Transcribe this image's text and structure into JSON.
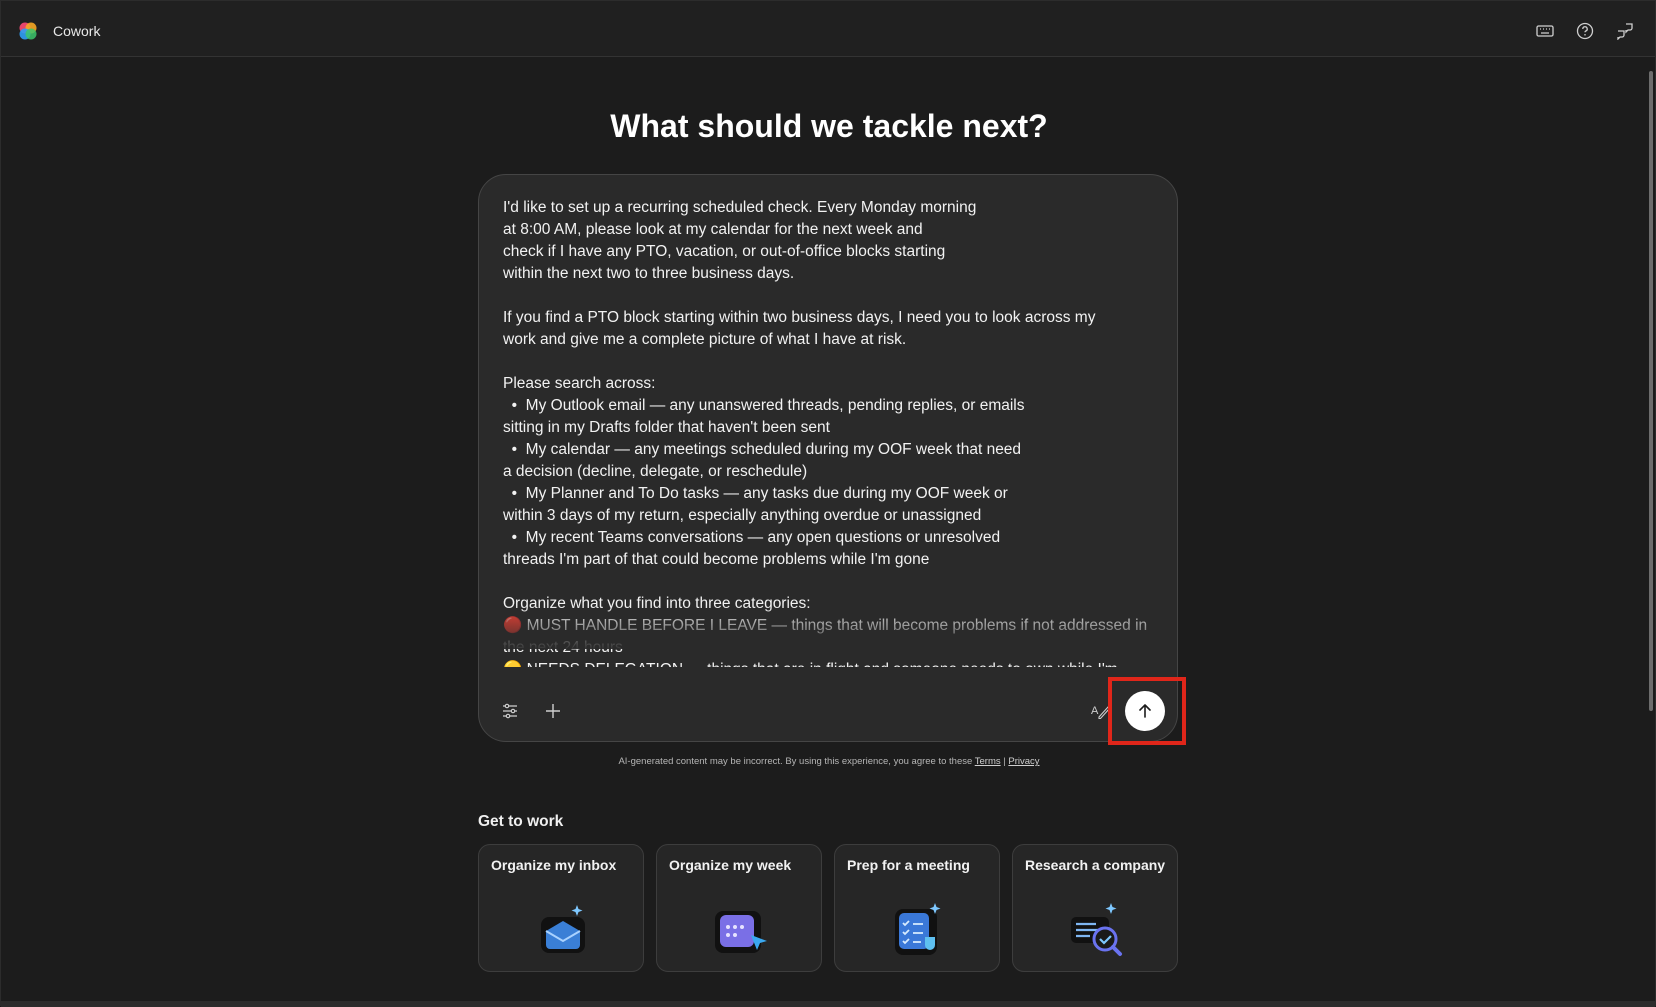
{
  "app": {
    "title": "Cowork"
  },
  "titlebar": {
    "icons": [
      "keyboard-icon",
      "help-icon",
      "feedback-icon"
    ]
  },
  "headline": "What should we tackle next?",
  "composer": {
    "text": "I'd like to set up a recurring scheduled check. Every Monday morning\nat 8:00 AM, please look at my calendar for the next week and\ncheck if I have any PTO, vacation, or out-of-office blocks starting\nwithin the next two to three business days.\n\nIf you find a PTO block starting within two business days, I need you to look across my\nwork and give me a complete picture of what I have at risk.\n\nPlease search across:\n  •  My Outlook email — any unanswered threads, pending replies, or emails\nsitting in my Drafts folder that haven't been sent\n  •  My calendar — any meetings scheduled during my OOF week that need\na decision (decline, delegate, or reschedule)\n  •  My Planner and To Do tasks — any tasks due during my OOF week or\nwithin 3 days of my return, especially anything overdue or unassigned\n  •  My recent Teams conversations — any open questions or unresolved\nthreads I'm part of that could become problems while I'm gone\n\nOrganize what you find into three categories:\n🔴 MUST HANDLE BEFORE I LEAVE — things that will become problems if not addressed in\nthe next 24 hours\n🟡 NEEDS DELEGATION — things that are in flight and someone needs to own while I'm",
    "tools_icon": "sliders-icon",
    "add_icon": "plus-icon",
    "proofing_icon": "spellcheck-icon",
    "send_icon": "arrow-up-icon"
  },
  "disclaimer": {
    "text": "AI-generated content may be incorrect. By using this experience, you agree to these ",
    "terms": "Terms",
    "separator": " | ",
    "privacy": "Privacy"
  },
  "get_to_work": {
    "title": "Get to work",
    "cards": [
      {
        "label": "Organize my inbox",
        "icon": "inbox-icon"
      },
      {
        "label": "Organize my week",
        "icon": "calendar-icon"
      },
      {
        "label": "Prep for a meeting",
        "icon": "checklist-icon"
      },
      {
        "label": "Research a company",
        "icon": "research-icon"
      }
    ]
  },
  "colors": {
    "background": "#1c1c1c",
    "composer": "#2a2a2a",
    "highlight": "#e0261a"
  }
}
